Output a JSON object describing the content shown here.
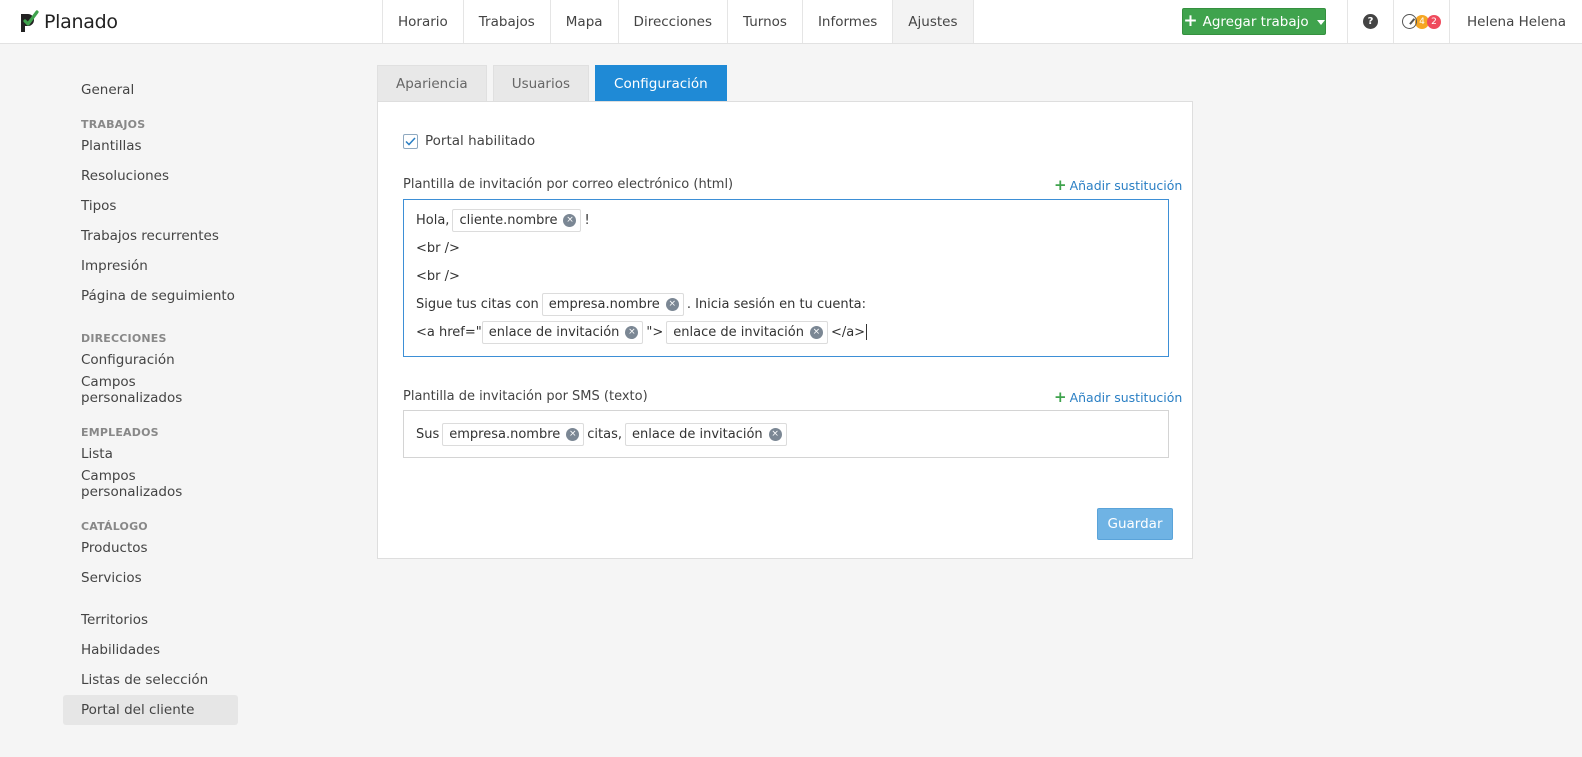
{
  "app": {
    "logo_text": "Planado"
  },
  "nav": {
    "items": [
      "Horario",
      "Trabajos",
      "Mapa",
      "Direcciones",
      "Turnos",
      "Informes",
      "Ajustes"
    ],
    "active": "Ajustes"
  },
  "header": {
    "add_button_label": "Agregar trabajo",
    "help_label": "?",
    "notifications": {
      "orange_count": "4",
      "red_count": "2"
    },
    "user_name": "Helena Helena"
  },
  "sidebar": {
    "general": "General",
    "trabajos": {
      "header": "TRABAJOS",
      "items": [
        "Plantillas",
        "Resoluciones",
        "Tipos",
        "Trabajos recurrentes",
        "Impresión",
        "Página de seguimiento"
      ]
    },
    "direcciones": {
      "header": "DIRECCIONES",
      "items": [
        "Configuración",
        "Campos personalizados"
      ]
    },
    "empleados": {
      "header": "EMPLEADOS",
      "items": [
        "Lista",
        "Campos personalizados"
      ]
    },
    "catalogo": {
      "header": "CATÁLOGO",
      "items": [
        "Productos",
        "Servicios"
      ]
    },
    "other": {
      "items": [
        "Territorios",
        "Habilidades",
        "Listas de selección",
        "Portal del cliente"
      ]
    },
    "active": "Portal del cliente"
  },
  "tabs": {
    "items": [
      "Apariencia",
      "Usuarios",
      "Configuración"
    ],
    "active": "Configuración"
  },
  "portal": {
    "enabled_label": "Portal habilitado",
    "enabled": true,
    "email_template": {
      "label": "Plantilla de invitación por correo electrónico (html)",
      "add_sub": "Añadir sustitución",
      "line1": {
        "text": "Hola,",
        "token": "cliente.nombre",
        "after": "!"
      },
      "line2": "<br />",
      "line3": "<br />",
      "line4": {
        "text": "Sigue tus citas con",
        "token": "empresa.nombre",
        "after": ". Inicia sesión en tu cuenta:"
      },
      "line5": {
        "text": "<a href=\"",
        "token1": "enlace de invitación",
        "mid": "\">",
        "token2": "enlace de invitación",
        "after": "</a>"
      }
    },
    "sms_template": {
      "label": "Plantilla de invitación por SMS (texto)",
      "add_sub": "Añadir sustitución",
      "text": "Sus",
      "token1": "empresa.nombre",
      "mid": "citas,",
      "token2": "enlace de invitación"
    },
    "save_label": "Guardar"
  },
  "colors": {
    "accent": "#1f8ad6",
    "primary_green": "#3fa34d",
    "save": "#6fb3e4",
    "link": "#2a7fc4"
  }
}
